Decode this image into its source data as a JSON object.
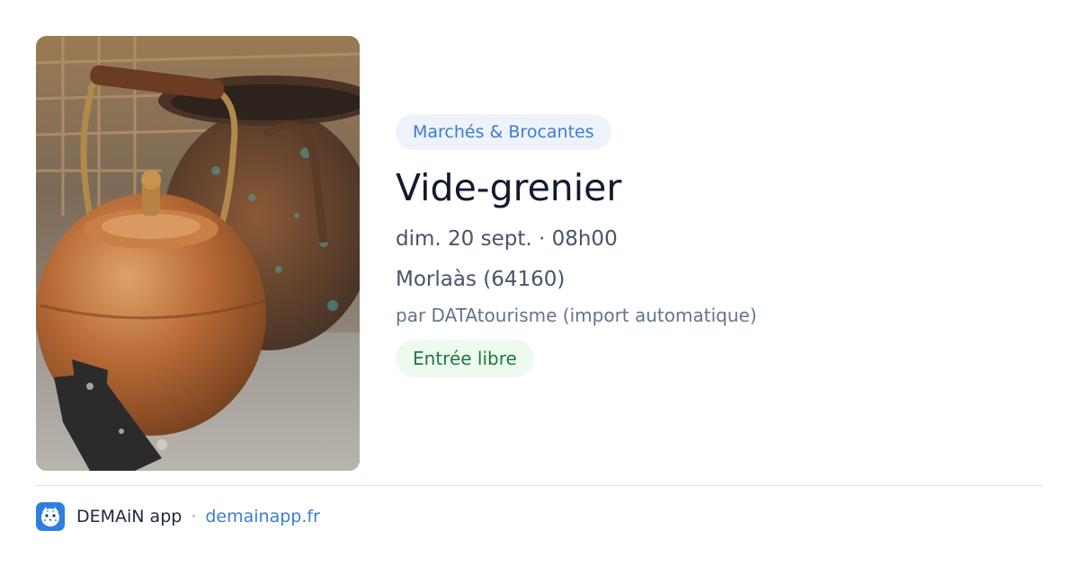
{
  "event": {
    "image_alt": "Copper kettle and cauldron at a flea market",
    "category": "Marchés & Brocantes",
    "title": "Vide-grenier",
    "datetime": "dim. 20 sept. · 08h00",
    "location": "Morlaàs (64160)",
    "source": "par DATAtourisme (import automatique)",
    "price": "Entrée libre"
  },
  "footer": {
    "app_name": "DEMAiN app",
    "separator": "·",
    "site": "demainapp.fr",
    "logo_icon": "snow-leopard-face-icon"
  },
  "colors": {
    "accent": "#3b7bd6",
    "category_badge_bg": "#eef3fb",
    "price_text": "#1f7a3c",
    "price_badge_bg": "#eefaf0"
  }
}
